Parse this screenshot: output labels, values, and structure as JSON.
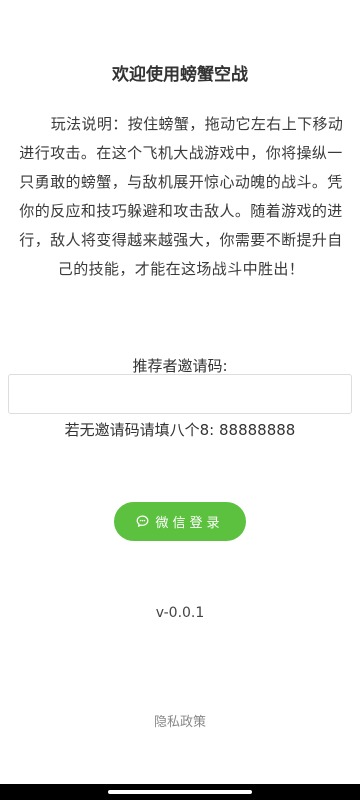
{
  "header": {
    "title": "欢迎使用螃蟹空战"
  },
  "instructions": {
    "text": "玩法说明：按住螃蟹，拖动它左右上下移动进行攻击。在这个飞机大战游戏中，你将操纵一只勇敢的螃蟹，与敌机展开惊心动魄的战斗。凭你的反应和技巧躲避和攻击敌人。随着游戏的进行，敌人将变得越来越强大，你需要不断提升自己的技能，才能在这场战斗中胜出！"
  },
  "invite": {
    "label": "推荐者邀请码:",
    "value": "",
    "placeholder": "",
    "hint": "若无邀请码请填八个8: 88888888"
  },
  "login": {
    "button_label": "微信登录",
    "icon": "chat-bubble-icon",
    "color": "#5dc140"
  },
  "footer": {
    "version": "v-0.0.1",
    "privacy_link": "隐私政策"
  }
}
